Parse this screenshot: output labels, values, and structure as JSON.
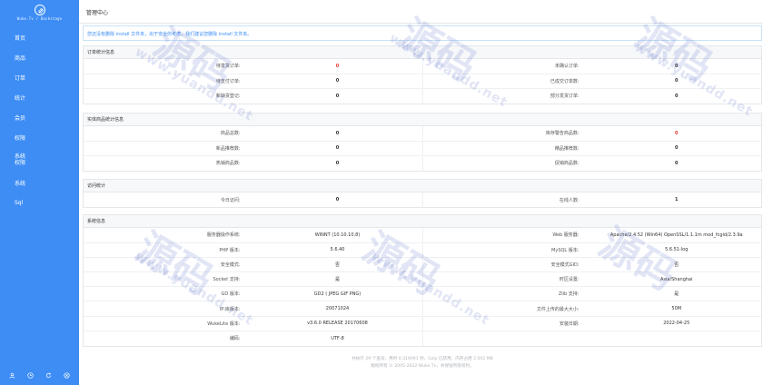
{
  "sidebar": {
    "brand": "Wuke.Tv / Backstage",
    "items": [
      {
        "label": "首页"
      },
      {
        "label": "商品"
      },
      {
        "label": "订单"
      },
      {
        "label": "统计"
      },
      {
        "label": "会员"
      },
      {
        "label": "权限"
      },
      {
        "label": "系统\n权限"
      },
      {
        "label": "系统"
      },
      {
        "label": "Sql"
      }
    ],
    "footer_icons": [
      "user-icon",
      "clock-icon",
      "refresh-icon",
      "logout-icon"
    ]
  },
  "header": {
    "title": "管理中心"
  },
  "alert": {
    "text": "您还没有删除 install 文件夹，出于安全的考虑，我们建议您删除 install 文件夹。"
  },
  "sections": {
    "orders": {
      "title": "订单统计信息",
      "rows": [
        {
          "l1": "待发货订单:",
          "v1": "0",
          "l2": "未确认订单:",
          "v2": "0"
        },
        {
          "l1": "待支付订单:",
          "v1": "0",
          "l2": "已成交订单数:",
          "v2": "0"
        },
        {
          "l1": "新缺货登记:",
          "v1": "0",
          "l2": "部分发货订单:",
          "v2": "0"
        }
      ]
    },
    "goods": {
      "title": "实体商品统计信息",
      "rows": [
        {
          "l1": "商品总数:",
          "v1": "0",
          "l2": "库存警告商品数:",
          "v2": "0"
        },
        {
          "l1": "新品推荐数:",
          "v1": "0",
          "l2": "精品推荐数:",
          "v2": "0"
        },
        {
          "l1": "热销商品数:",
          "v1": "0",
          "l2": "促销商品数:",
          "v2": "0"
        }
      ]
    },
    "visits": {
      "title": "访问统计",
      "rows": [
        {
          "l1": "今日访问:",
          "v1": "0",
          "l2": "在线人数:",
          "v2": "1"
        }
      ]
    },
    "system": {
      "title": "系统信息",
      "rows": [
        {
          "l1": "服务器操作系统:",
          "v1": "WINNT (10.10.10.8)",
          "l2": "Web 服务器:",
          "v2": "Apache/2.4.52 (Win64) OpenSSL/1.1.1m mod_fcgid/2.3.9a"
        },
        {
          "l1": "PHP 版本:",
          "v1": "5.6.40",
          "l2": "MySQL 版本:",
          "v2": "5.6.51-log"
        },
        {
          "l1": "安全模式:",
          "v1": "否",
          "l2": "安全模式GID:",
          "v2": "否"
        },
        {
          "l1": "Socket 支持:",
          "v1": "是",
          "l2": "时区设置:",
          "v2": "Asia/Shanghai"
        },
        {
          "l1": "GD 版本:",
          "v1": "GD2 ( JPEG GIF PNG)",
          "l2": "Zlib 支持:",
          "v2": "是"
        },
        {
          "l1": "IP 库版本:",
          "v1": "20071024",
          "l2": "文件上传的最大大小:",
          "v2": "50M"
        },
        {
          "l1": "WukeLite 版本:",
          "v1": "v3.6.0 RELEASE 20170608",
          "l2": "安装日期:",
          "v2": "2022-04-25"
        },
        {
          "l1": "编码:",
          "v1": "UTF-8",
          "l2": "",
          "v2": ""
        }
      ]
    }
  },
  "footer": {
    "line1": "共执行 29 个查询，用时 0.316091 秒，Gzip 已禁用，内存占用 2.502 MB",
    "line2": "版权所有 © 2005-2022 Wuke.Tv，并保留所有权利。"
  },
  "watermark": {
    "big": "源码",
    "url": "www.yuandd.net"
  },
  "colors": {
    "sidebar": "#3d8df5",
    "accent": "#3d8df5",
    "alert_value": "#e53935"
  }
}
